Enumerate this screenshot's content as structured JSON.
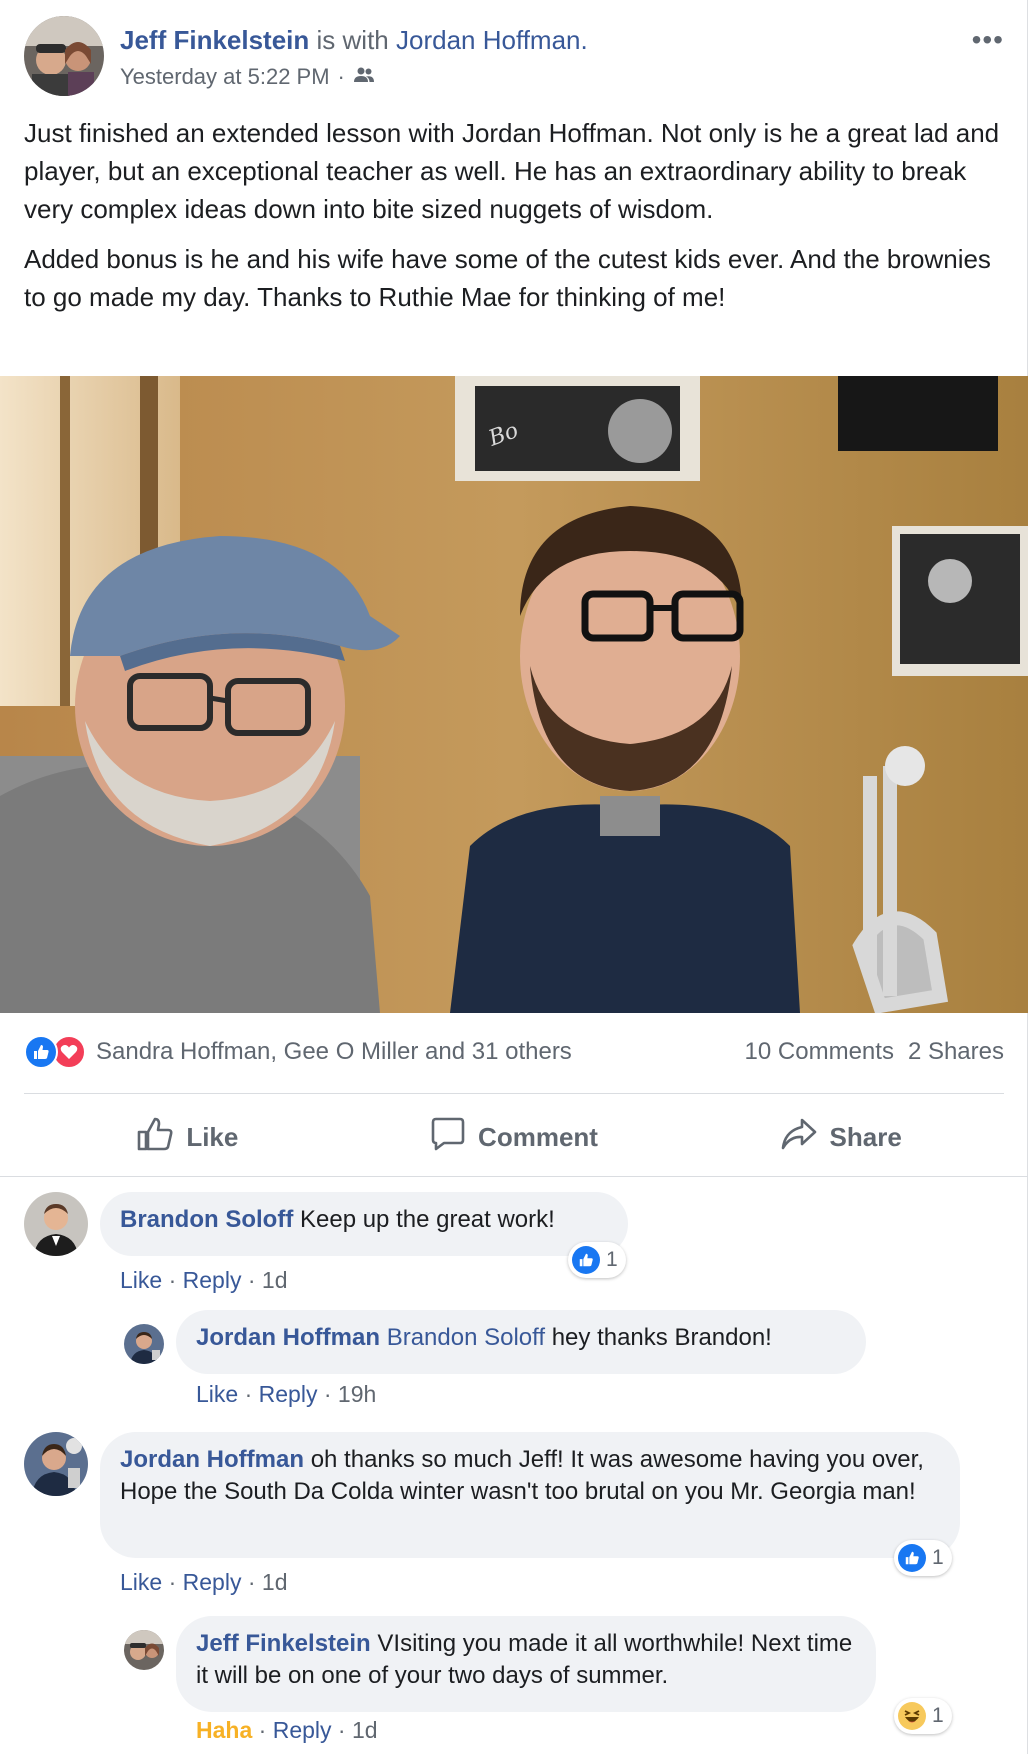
{
  "post": {
    "author": "Jeff Finkelstein",
    "with_text": "is with",
    "tagged": "Jordan Hoffman.",
    "timestamp": "Yesterday at 5:22 PM",
    "separator": "·",
    "more_icon": "more-horizontal-icon",
    "paragraphs": [
      "Just finished an extended lesson with Jordan Hoffman. Not only is he a great lad and player, but an exceptional teacher as well. He has an extraordinary ability to break very complex ideas down into bite sized nuggets of wisdom.",
      "Added bonus is he and his wife have some of the cutest kids ever. And the brownies to go made my day. Thanks to Ruthie Mae for thinking of me!"
    ]
  },
  "stats": {
    "reactions_text": "Sandra Hoffman, Gee O Miller and 31 others",
    "comments": "10 Comments",
    "shares": "2 Shares"
  },
  "actions": {
    "like": "Like",
    "comment": "Comment",
    "share": "Share"
  },
  "comments": [
    {
      "author": "Brandon Soloff",
      "text": "Keep up the great work!",
      "like": "Like",
      "reply": "Reply",
      "time": "1d",
      "reaction_count": "1",
      "reaction": "like-icon"
    },
    {
      "author": "Jordan Hoffman",
      "mention": "Brandon Soloff",
      "text": "hey thanks Brandon!",
      "like": "Like",
      "reply": "Reply",
      "time": "19h"
    },
    {
      "author": "Jordan Hoffman",
      "text": "oh thanks so much Jeff! It was awesome having you over, Hope the South Da Colda winter wasn't too brutal on you Mr. Georgia man!",
      "like": "Like",
      "reply": "Reply",
      "time": "1d",
      "reaction_count": "1",
      "reaction": "like-icon"
    },
    {
      "author": "Jeff Finkelstein",
      "text": "VIsiting you made it all worthwhile! Next time it will be on one of your two days of summer.",
      "like": "Haha",
      "reply": "Reply",
      "time": "1d",
      "reaction_count": "1",
      "reaction": "haha-icon"
    }
  ],
  "colors": {
    "link_blue": "#385898",
    "like_blue": "#1877f2",
    "love_red": "#f33e58",
    "haha_yellow": "#f7b125",
    "bubble_gray": "#f0f2f5",
    "meta_gray": "#606770"
  }
}
